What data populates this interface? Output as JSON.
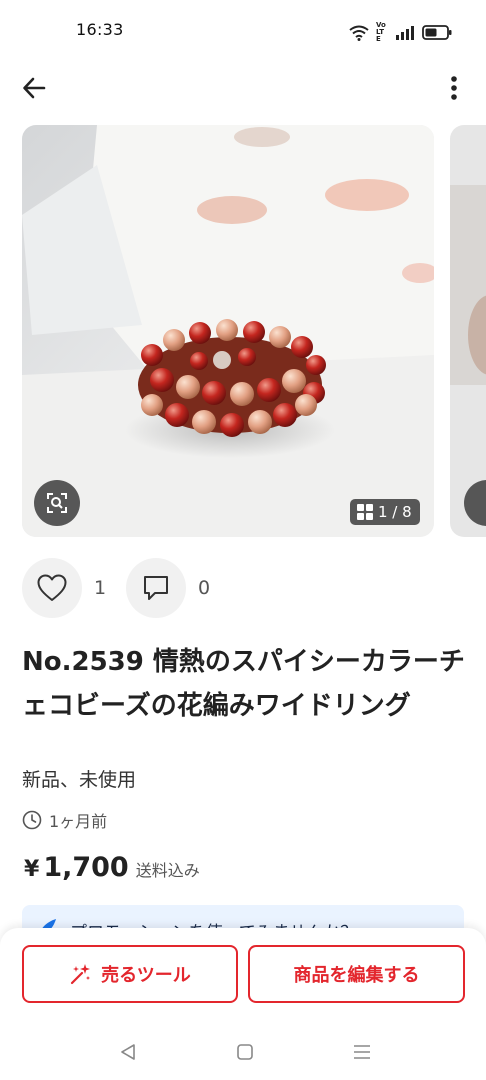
{
  "status_bar": {
    "time": "16:33",
    "network_label": "Vo LTE"
  },
  "header": {
    "back_icon": "arrow-left-icon",
    "more_icon": "more-vertical-icon"
  },
  "gallery": {
    "counter": "1 / 8",
    "lens_icon": "image-search-icon",
    "grid_icon": "grid-icon"
  },
  "actions": {
    "like_count": "1",
    "comment_count": "0"
  },
  "item": {
    "title": "No.2539  情熱のスパイシーカラーチェコビーズの花編みワイドリング",
    "condition": "新品、未使用",
    "listed": "1ヶ月前",
    "price_symbol": "¥",
    "price": "1,700",
    "shipping": "送料込み"
  },
  "promo": {
    "text": "プロモーションを使ってみませんか？"
  },
  "bottom": {
    "sell_tools_label": "売るツール",
    "edit_label": "商品を編集する"
  },
  "colors": {
    "accent": "#e3262d",
    "promo_bg": "#eaf3ff",
    "promo_icon": "#1a73e8"
  }
}
